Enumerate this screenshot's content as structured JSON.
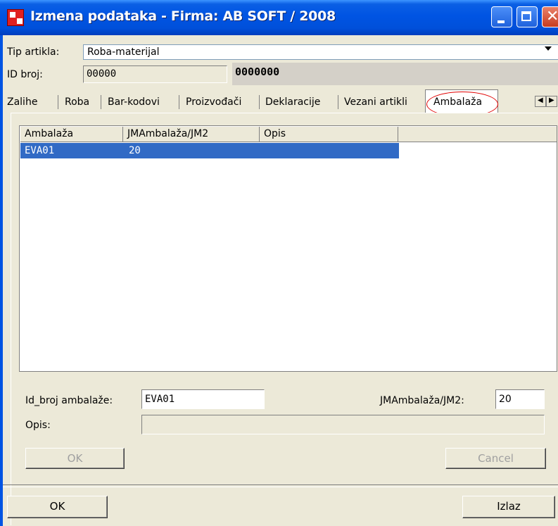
{
  "window": {
    "title": "Izmena podataka - Firma:  AB SOFT / 2008"
  },
  "header": {
    "tip_artikla_label": "Tip artikla:",
    "tip_artikla_value": "Roba-materijal",
    "id_broj_label": "ID broj:",
    "id_broj_value": "00000",
    "code_value": "0000000"
  },
  "tabs": [
    {
      "label": "Zalihe"
    },
    {
      "label": "Roba"
    },
    {
      "label": "Bar-kodovi"
    },
    {
      "label": "Proizvođači"
    },
    {
      "label": "Deklaracije"
    },
    {
      "label": "Vezani artikli"
    },
    {
      "label": "Ambalaža",
      "active": true
    }
  ],
  "grid": {
    "columns": [
      "Ambalaža",
      "JMAmbalaža/JM2",
      "Opis"
    ],
    "rows": [
      {
        "ambalaza": "EVA01",
        "jm": "20",
        "opis": "",
        "selected": true
      }
    ]
  },
  "detail": {
    "id_label": "Id_broj ambalaže:",
    "id_value": "EVA01",
    "jm_label": "JMAmbalaža/JM2:",
    "jm_value": "20",
    "opis_label": "Opis:",
    "opis_value": "",
    "ok_label": "OK",
    "cancel_label": "Cancel"
  },
  "footer": {
    "ok_label": "OK",
    "izlaz_label": "Izlaz"
  },
  "colors": {
    "titlebar": "#0054e3",
    "selection": "#316ac5",
    "annotation_circle": "#e00000"
  }
}
